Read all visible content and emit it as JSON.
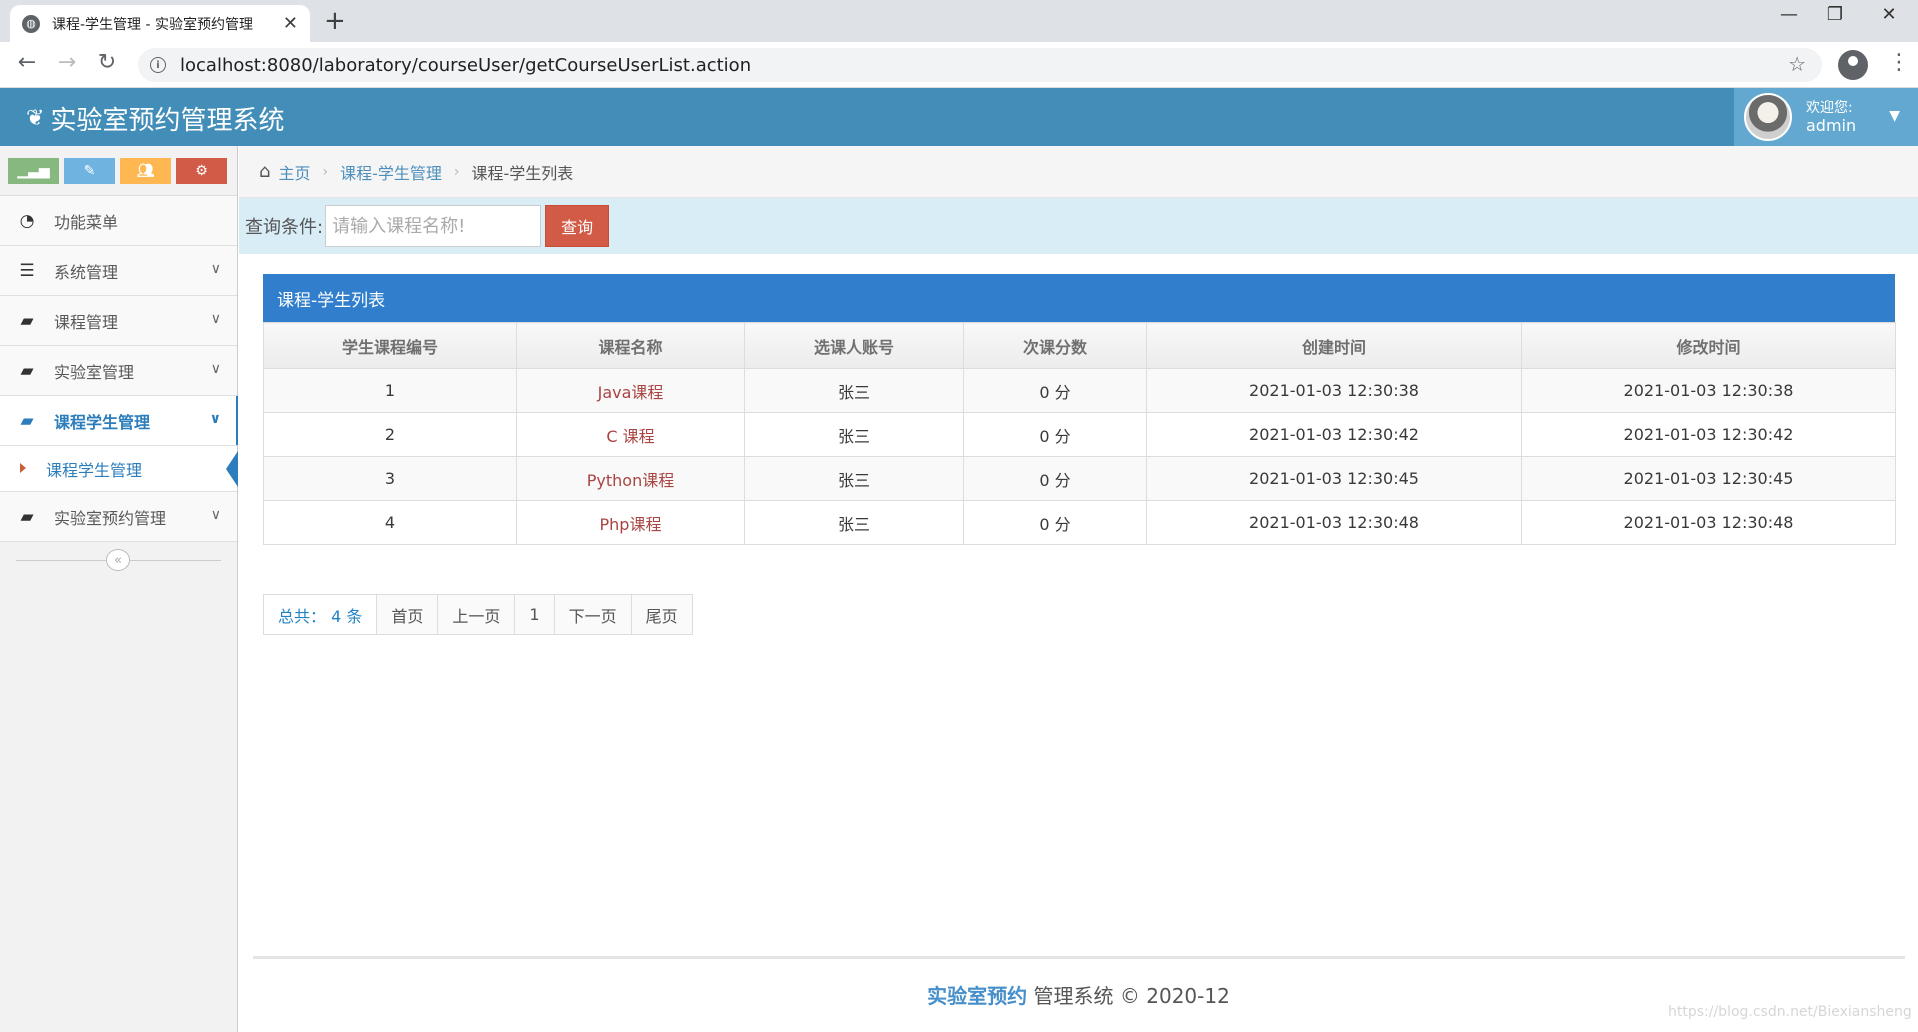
{
  "browser": {
    "tab_title": "课程-学生管理 - 实验室预约管理",
    "tab_close": "✕",
    "new_tab": "+",
    "url": "localhost:8080/laboratory/courseUser/getCourseUserList.action",
    "window_controls": [
      "—",
      "❐",
      "✕"
    ]
  },
  "header": {
    "brand": "实验室预约管理系统",
    "welcome": "欢迎您:",
    "username": "admin"
  },
  "sidebar": {
    "items": [
      {
        "label": "功能菜单",
        "icon": "dashboard-icon"
      },
      {
        "label": "系统管理",
        "icon": "list-icon"
      },
      {
        "label": "课程管理",
        "icon": "briefcase-icon"
      },
      {
        "label": "实验室管理",
        "icon": "briefcase-icon"
      },
      {
        "label": "课程学生管理",
        "icon": "briefcase-icon"
      },
      {
        "label": "实验室预约管理",
        "icon": "briefcase-icon"
      }
    ],
    "submenu": {
      "label": "课程学生管理"
    }
  },
  "breadcrumb": {
    "home": "主页",
    "level1": "课程-学生管理",
    "current": "课程-学生列表"
  },
  "search": {
    "label": "查询条件:",
    "placeholder": "请输入课程名称!",
    "button": "查询"
  },
  "table": {
    "title": "课程-学生列表",
    "columns": [
      "学生课程编号",
      "课程名称",
      "选课人账号",
      "次课分数",
      "创建时间",
      "修改时间"
    ],
    "rows": [
      [
        "1",
        "Java课程",
        "张三",
        "0 分",
        "2021-01-03 12:30:38",
        "2021-01-03 12:30:38"
      ],
      [
        "2",
        "C 课程",
        "张三",
        "0 分",
        "2021-01-03 12:30:42",
        "2021-01-03 12:30:42"
      ],
      [
        "3",
        "Python课程",
        "张三",
        "0 分",
        "2021-01-03 12:30:45",
        "2021-01-03 12:30:45"
      ],
      [
        "4",
        "Php课程",
        "张三",
        "0 分",
        "2021-01-03 12:30:48",
        "2021-01-03 12:30:48"
      ]
    ]
  },
  "pager": {
    "total": "总共： 4 条",
    "first": "首页",
    "prev": "上一页",
    "page": "1",
    "next": "下一页",
    "last": "尾页"
  },
  "footer": {
    "brand": "实验室预约",
    "rest": " 管理系统 © 2020-12"
  },
  "watermark": "https://blog.csdn.net/Biexiansheng"
}
